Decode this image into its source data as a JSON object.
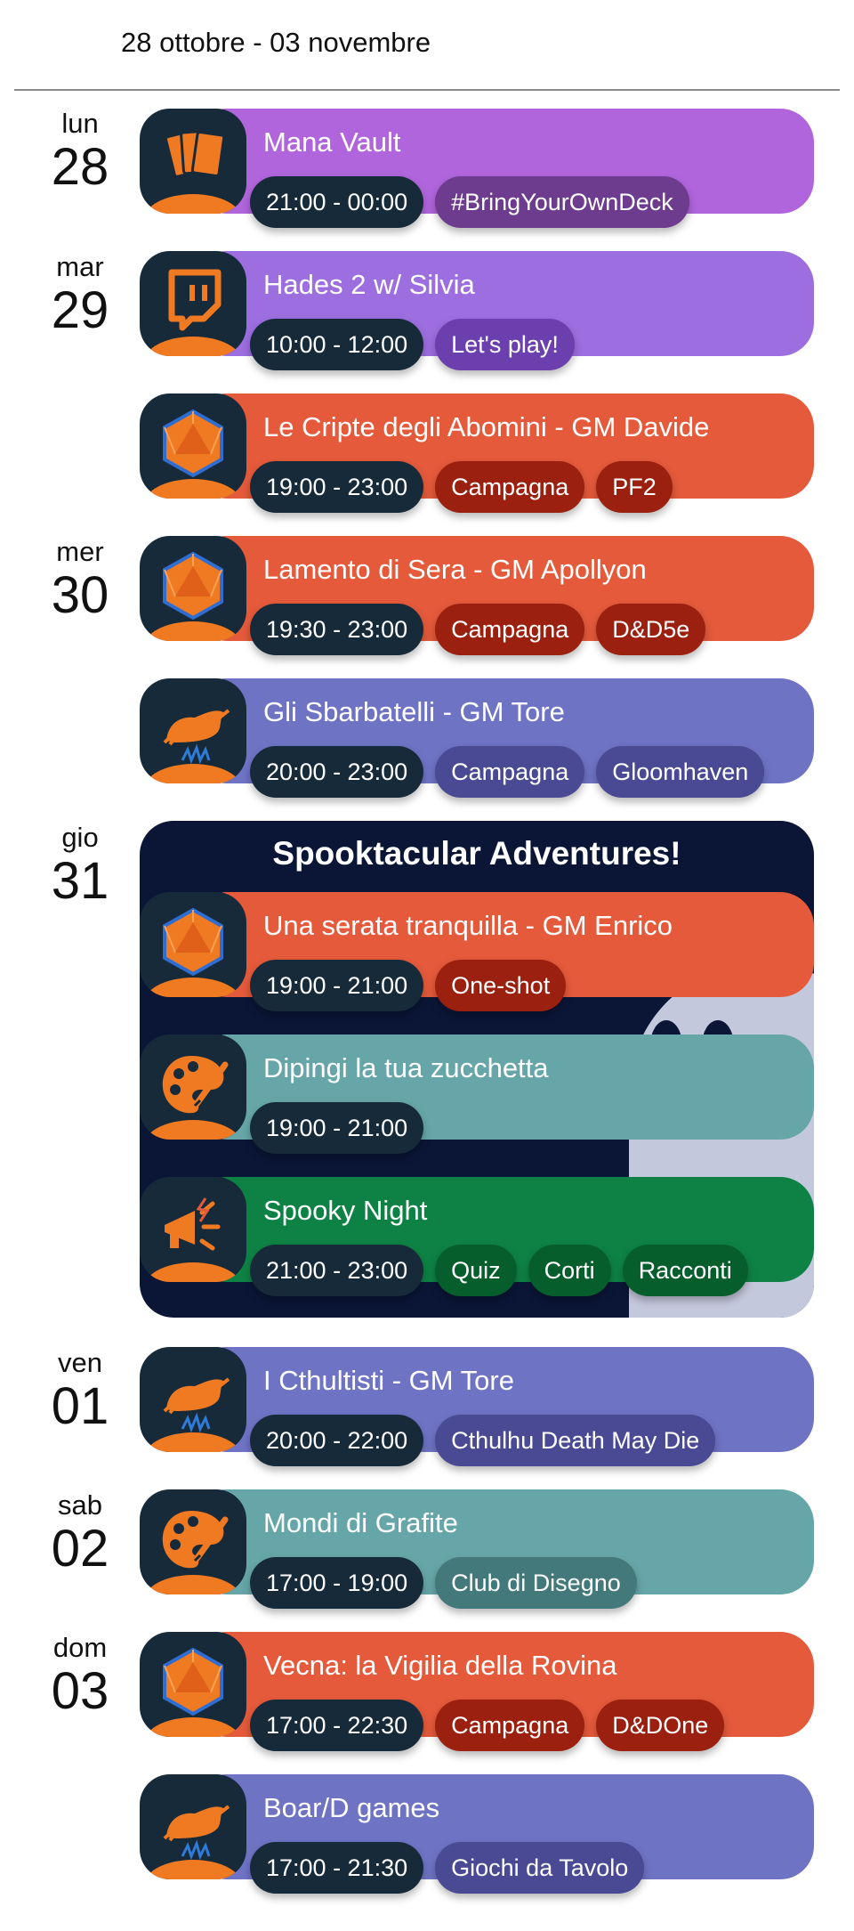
{
  "header": {
    "week_range": "28 ottobre - 03 novembre"
  },
  "colors": {
    "purple_dark": "#b065dc",
    "purple": "#9c6ee0",
    "red": "#e45a3b",
    "indigo": "#6f73c4",
    "teal": "#67a6a8",
    "green": "#0e8244",
    "time_pill": "#172a3a",
    "icon_bg": "#172a3a",
    "icon_accent": "#f07a22"
  },
  "days": [
    {
      "name": "lun",
      "num": "28"
    },
    {
      "name": "mar",
      "num": "29"
    },
    {
      "name": "mer",
      "num": "30"
    },
    {
      "name": "gio",
      "num": "31"
    },
    {
      "name": "ven",
      "num": "01"
    },
    {
      "name": "sab",
      "num": "02"
    },
    {
      "name": "dom",
      "num": "03"
    }
  ],
  "special": {
    "title": "Spooktacular Adventures!"
  },
  "events": [
    {
      "title": "Mana Vault",
      "icon": "cards-icon",
      "time": "21:00 - 00:00",
      "tags": [
        "#BringYourOwnDeck"
      ]
    },
    {
      "title": "Hades 2 w/ Silvia",
      "icon": "twitch-icon",
      "time": "10:00 - 12:00",
      "tags": [
        "Let's play!"
      ]
    },
    {
      "title": "Le Cripte degli Abomini - GM Davide",
      "icon": "d20-icon",
      "time": "19:00 - 23:00",
      "tags": [
        "Campagna",
        "PF2"
      ]
    },
    {
      "title": "Lamento di Sera - GM Apollyon",
      "icon": "d20-icon",
      "time": "19:30 - 23:00",
      "tags": [
        "Campagna",
        "D&D5e"
      ]
    },
    {
      "title": "Gli Sbarbatelli - GM Tore",
      "icon": "boar-icon",
      "time": "20:00 - 23:00",
      "tags": [
        "Campagna",
        "Gloomhaven"
      ]
    },
    {
      "title": "Una serata tranquilla - GM Enrico",
      "icon": "d20-icon",
      "time": "19:00 - 21:00",
      "tags": [
        "One-shot"
      ]
    },
    {
      "title": "Dipingi la tua zucchetta",
      "icon": "palette-icon",
      "time": "19:00 - 21:00",
      "tags": []
    },
    {
      "title": "Spooky Night",
      "icon": "megaphone-icon",
      "time": "21:00 - 23:00",
      "tags": [
        "Quiz",
        "Corti",
        "Racconti"
      ]
    },
    {
      "title": "I Cthultisti - GM Tore",
      "icon": "boar-icon",
      "time": "20:00 - 22:00",
      "tags": [
        "Cthulhu Death May Die"
      ]
    },
    {
      "title": "Mondi di Grafite",
      "icon": "palette-icon",
      "time": "17:00 - 19:00",
      "tags": [
        "Club di Disegno"
      ]
    },
    {
      "title": "Vecna: la Vigilia della Rovina",
      "icon": "d20-icon",
      "time": "17:00 - 22:30",
      "tags": [
        "Campagna",
        "D&DOne"
      ]
    },
    {
      "title": "Boar/D games",
      "icon": "boar-icon",
      "time": "17:00 - 21:30",
      "tags": [
        "Giochi da Tavolo"
      ]
    }
  ]
}
